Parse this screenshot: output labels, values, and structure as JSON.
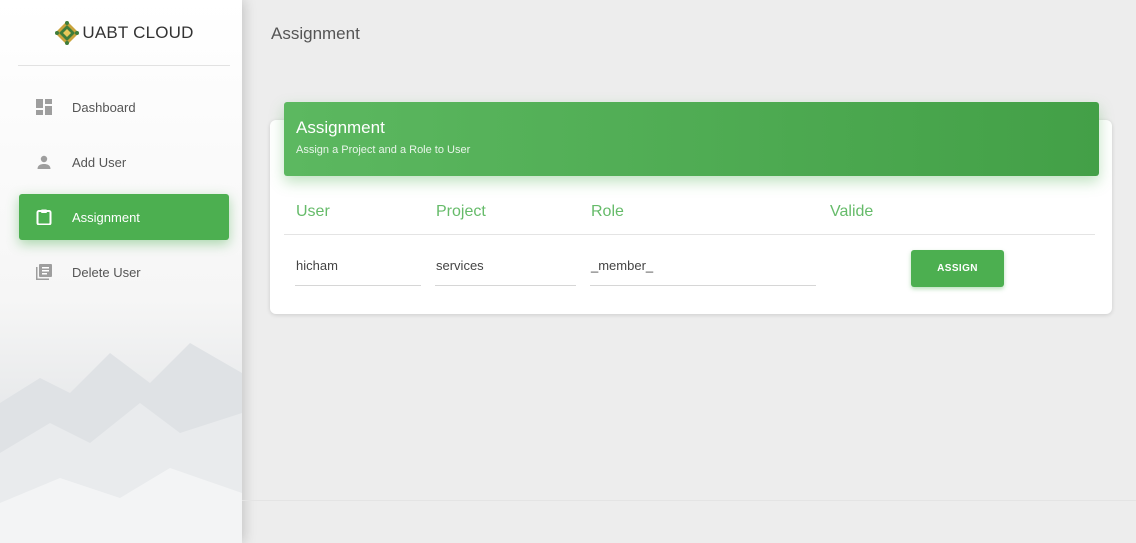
{
  "app": {
    "brand": "UABT CLOUD",
    "logo_icon": "mosaic-logo-icon"
  },
  "sidebar": {
    "items": [
      {
        "label": "Dashboard",
        "icon": "dashboard-icon",
        "active": false
      },
      {
        "label": "Add User",
        "icon": "person-icon",
        "active": false
      },
      {
        "label": "Assignment",
        "icon": "clipboard-icon",
        "active": true
      },
      {
        "label": "Delete User",
        "icon": "library-books-icon",
        "active": false
      }
    ]
  },
  "header": {
    "title": "Assignment"
  },
  "card": {
    "title": "Assignment",
    "subtitle": "Assign a Project and a Role to User",
    "columns": [
      "User",
      "Project",
      "Role",
      "Valide"
    ],
    "row": {
      "user": "hicham",
      "project": "services",
      "role": "_member_"
    },
    "button_label": "ASSIGN"
  },
  "colors": {
    "accent": "#4caf50",
    "accent_light": "#66bb6a",
    "background": "#ededed"
  }
}
